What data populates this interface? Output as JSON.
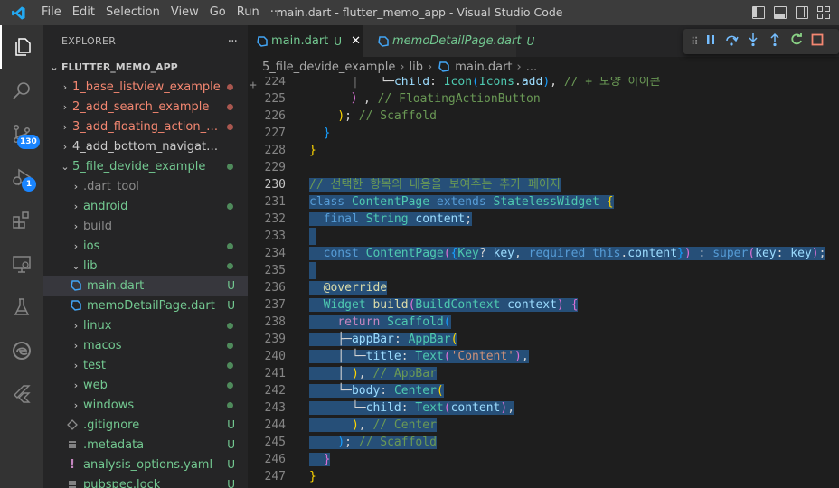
{
  "window": {
    "title": "main.dart - flutter_memo_app - Visual Studio Code",
    "menu": [
      "File",
      "Edit",
      "Selection",
      "View",
      "Go",
      "Run",
      "···"
    ]
  },
  "activity_bar": {
    "source_control_badge": "130",
    "run_debug_badge": "1"
  },
  "explorer": {
    "header": "EXPLORER",
    "more": "···",
    "root": "FLUTTER_MEMO_APP",
    "items": [
      {
        "label": "1_base_listview_example",
        "chevron": "›",
        "color": "#f48771",
        "deco": "dot",
        "deco_color": "#a9574f"
      },
      {
        "label": "2_add_search_example",
        "chevron": "›",
        "color": "#f48771",
        "deco": "dot",
        "deco_color": "#a9574f"
      },
      {
        "label": "3_add_floating_action_but...",
        "chevron": "›",
        "color": "#f48771",
        "deco": "dot",
        "deco_color": "#a9574f"
      },
      {
        "label": "4_add_bottom_navigation_bar_...",
        "chevron": "›",
        "color": "#cccccc",
        "deco": "",
        "deco_color": ""
      },
      {
        "label": "5_file_devide_example",
        "chevron": "⌄",
        "color": "#73c991",
        "deco": "dot",
        "deco_color": "#4f8a5b"
      },
      {
        "label": ".dart_tool",
        "chevron": "›",
        "color": "#8c8c8c",
        "deco": "",
        "deco_color": ""
      },
      {
        "label": "android",
        "chevron": "›",
        "color": "#73c991",
        "deco": "dot",
        "deco_color": "#4f8a5b"
      },
      {
        "label": "build",
        "chevron": "›",
        "color": "#8c8c8c",
        "deco": "",
        "deco_color": ""
      },
      {
        "label": "ios",
        "chevron": "›",
        "color": "#73c991",
        "deco": "dot",
        "deco_color": "#4f8a5b"
      },
      {
        "label": "lib",
        "chevron": "⌄",
        "color": "#73c991",
        "deco": "dot",
        "deco_color": "#4f8a5b"
      },
      {
        "label": "main.dart",
        "chevron": "",
        "color": "#73c991",
        "deco": "U",
        "deco_color": "#73c991",
        "icon": "dart"
      },
      {
        "label": "memoDetailPage.dart",
        "chevron": "",
        "color": "#73c991",
        "deco": "U",
        "deco_color": "#73c991",
        "icon": "dart"
      },
      {
        "label": "linux",
        "chevron": "›",
        "color": "#73c991",
        "deco": "dot",
        "deco_color": "#4f8a5b"
      },
      {
        "label": "macos",
        "chevron": "›",
        "color": "#73c991",
        "deco": "dot",
        "deco_color": "#4f8a5b"
      },
      {
        "label": "test",
        "chevron": "›",
        "color": "#73c991",
        "deco": "dot",
        "deco_color": "#4f8a5b"
      },
      {
        "label": "web",
        "chevron": "›",
        "color": "#73c991",
        "deco": "dot",
        "deco_color": "#4f8a5b"
      },
      {
        "label": "windows",
        "chevron": "›",
        "color": "#73c991",
        "deco": "dot",
        "deco_color": "#4f8a5b"
      },
      {
        "label": ".gitignore",
        "chevron": "",
        "color": "#73c991",
        "deco": "U",
        "deco_color": "#73c991",
        "icon": "git"
      },
      {
        "label": ".metadata",
        "chevron": "",
        "color": "#73c991",
        "deco": "U",
        "deco_color": "#73c991",
        "icon": "lines"
      },
      {
        "label": "analysis_options.yaml",
        "chevron": "",
        "color": "#73c991",
        "deco": "U",
        "deco_color": "#73c991",
        "icon": "yaml"
      },
      {
        "label": "pubspec.lock",
        "chevron": "",
        "color": "#73c991",
        "deco": "U",
        "deco_color": "#73c991",
        "icon": "lines"
      }
    ]
  },
  "tabs": [
    {
      "label": "main.dart",
      "status": "U",
      "active": true,
      "close": "✕"
    },
    {
      "label": "memoDetailPage.dart",
      "status": "U",
      "active": false
    }
  ],
  "breadcrumb": [
    "5_file_devide_example",
    "lib",
    "main.dart",
    "..."
  ],
  "code_lines": [
    {
      "n": "224",
      "hl": false,
      "toks": [
        [
          "gd",
          "      │   "
        ],
        [
          "pu",
          "└─"
        ],
        [
          "va",
          "child"
        ],
        [
          "pu",
          ": "
        ],
        [
          "ty",
          "Icon"
        ],
        [
          "b3",
          "("
        ],
        [
          "ty",
          "Icons"
        ],
        [
          "pu",
          "."
        ],
        [
          "va",
          "add"
        ],
        [
          "b3",
          ")"
        ],
        [
          "pu",
          ", "
        ],
        [
          "cm",
          "// + 모양 아이콘"
        ]
      ]
    },
    {
      "n": "225",
      "hl": false,
      "toks": [
        [
          "gd",
          "      "
        ],
        [
          "b2",
          "）"
        ],
        [
          "pu",
          ", "
        ],
        [
          "cm",
          "// FloatingActionButton"
        ]
      ]
    },
    {
      "n": "226",
      "hl": false,
      "toks": [
        [
          "gd",
          "    "
        ],
        [
          "b1",
          ")"
        ],
        [
          "pu",
          "; "
        ],
        [
          "cm",
          "// Scaffold"
        ]
      ]
    },
    {
      "n": "227",
      "hl": false,
      "toks": [
        [
          "gd",
          "  "
        ],
        [
          "b3",
          "}"
        ]
      ]
    },
    {
      "n": "228",
      "hl": false,
      "toks": [
        [
          "b1",
          "}"
        ]
      ]
    },
    {
      "n": "229",
      "hl": false,
      "toks": [
        [
          "pu",
          ""
        ]
      ]
    },
    {
      "n": "230",
      "hl": true,
      "toks": [
        [
          "cm",
          "// 선택한 항목의 내용을 보여주는 추가 페이지"
        ]
      ]
    },
    {
      "n": "231",
      "hl": true,
      "toks": [
        [
          "kw",
          "class "
        ],
        [
          "ty",
          "ContentPage "
        ],
        [
          "kw",
          "extends "
        ],
        [
          "ty",
          "StatelessWidget "
        ],
        [
          "b1",
          "{"
        ]
      ]
    },
    {
      "n": "232",
      "hl": true,
      "toks": [
        [
          "pu",
          "  "
        ],
        [
          "kw",
          "final "
        ],
        [
          "ty",
          "String "
        ],
        [
          "va",
          "content"
        ],
        [
          "pu",
          ";"
        ]
      ]
    },
    {
      "n": "233",
      "hl": true,
      "toks": [
        [
          "pu",
          ""
        ]
      ]
    },
    {
      "n": "234",
      "hl": true,
      "toks": [
        [
          "pu",
          "  "
        ],
        [
          "kw",
          "const "
        ],
        [
          "ty",
          "ContentPage"
        ],
        [
          "b2",
          "("
        ],
        [
          "b3",
          "{"
        ],
        [
          "ty",
          "Key"
        ],
        [
          "pu",
          "? "
        ],
        [
          "va",
          "key"
        ],
        [
          "pu",
          ", "
        ],
        [
          "kw",
          "required "
        ],
        [
          "kw",
          "this"
        ],
        [
          "pu",
          "."
        ],
        [
          "va",
          "content"
        ],
        [
          "b3",
          "}"
        ],
        [
          "b2",
          ")"
        ],
        [
          "pu",
          " : "
        ],
        [
          "kw",
          "super"
        ],
        [
          "b2",
          "("
        ],
        [
          "va",
          "key"
        ],
        [
          "pu",
          ": "
        ],
        [
          "va",
          "key"
        ],
        [
          "b2",
          ")"
        ],
        [
          "pu",
          ";"
        ]
      ]
    },
    {
      "n": "235",
      "hl": true,
      "toks": [
        [
          "pu",
          ""
        ]
      ]
    },
    {
      "n": "236",
      "hl": true,
      "toks": [
        [
          "pu",
          "  "
        ],
        [
          "fn",
          "@override"
        ]
      ]
    },
    {
      "n": "237",
      "hl": true,
      "toks": [
        [
          "pu",
          "  "
        ],
        [
          "ty",
          "Widget "
        ],
        [
          "fn",
          "build"
        ],
        [
          "b2",
          "("
        ],
        [
          "ty",
          "BuildContext "
        ],
        [
          "va",
          "context"
        ],
        [
          "b2",
          ")"
        ],
        [
          "pu",
          " "
        ],
        [
          "b2",
          "{"
        ]
      ]
    },
    {
      "n": "238",
      "hl": true,
      "toks": [
        [
          "pu",
          "    "
        ],
        [
          "kc",
          "return "
        ],
        [
          "ty",
          "Scaffold"
        ],
        [
          "b3",
          "("
        ]
      ]
    },
    {
      "n": "239",
      "hl": true,
      "toks": [
        [
          "pu",
          "    ├─"
        ],
        [
          "va",
          "appBar"
        ],
        [
          "pu",
          ": "
        ],
        [
          "ty",
          "AppBar"
        ],
        [
          "b1",
          "("
        ]
      ]
    },
    {
      "n": "240",
      "hl": true,
      "toks": [
        [
          "pu",
          "    │ └─"
        ],
        [
          "va",
          "title"
        ],
        [
          "pu",
          ": "
        ],
        [
          "ty",
          "Text"
        ],
        [
          "b2",
          "("
        ],
        [
          "st",
          "'Content'"
        ],
        [
          "b2",
          ")"
        ],
        [
          "pu",
          ","
        ]
      ]
    },
    {
      "n": "241",
      "hl": true,
      "toks": [
        [
          "pu",
          "    │ "
        ],
        [
          "b1",
          ")"
        ],
        [
          "pu",
          ", "
        ],
        [
          "cm",
          "// AppBar"
        ]
      ]
    },
    {
      "n": "242",
      "hl": true,
      "toks": [
        [
          "pu",
          "    └─"
        ],
        [
          "va",
          "body"
        ],
        [
          "pu",
          ": "
        ],
        [
          "ty",
          "Center"
        ],
        [
          "b1",
          "("
        ]
      ]
    },
    {
      "n": "243",
      "hl": true,
      "toks": [
        [
          "pu",
          "      └─"
        ],
        [
          "va",
          "child"
        ],
        [
          "pu",
          ": "
        ],
        [
          "ty",
          "Text"
        ],
        [
          "b2",
          "("
        ],
        [
          "va",
          "content"
        ],
        [
          "b2",
          ")"
        ],
        [
          "pu",
          ","
        ]
      ]
    },
    {
      "n": "244",
      "hl": true,
      "toks": [
        [
          "pu",
          "      "
        ],
        [
          "b1",
          ")"
        ],
        [
          "pu",
          ", "
        ],
        [
          "cm",
          "// Center"
        ]
      ]
    },
    {
      "n": "245",
      "hl": true,
      "toks": [
        [
          "pu",
          "    "
        ],
        [
          "b3",
          ")"
        ],
        [
          "pu",
          "; "
        ],
        [
          "cm",
          "// Scaffold"
        ]
      ]
    },
    {
      "n": "246",
      "hl": true,
      "toks": [
        [
          "pu",
          "  "
        ],
        [
          "b2",
          "}"
        ]
      ]
    },
    {
      "n": "247",
      "hl": false,
      "toks": [
        [
          "b1",
          "}"
        ]
      ]
    }
  ],
  "colors": {
    "accent": "#007acc",
    "badge": "#1a85ff",
    "dart_icon": "#42a5f5"
  }
}
